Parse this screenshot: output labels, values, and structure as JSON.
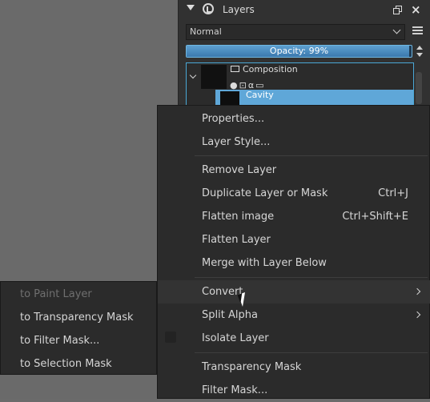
{
  "docker": {
    "title": "Layers",
    "blend_mode": "Normal",
    "opacity_text": "Opacity:  99%",
    "opacity_value": 0.99,
    "layers": [
      {
        "name": "Composition",
        "type": "group"
      },
      {
        "name": "Cavity",
        "type": "paint",
        "selected": true
      }
    ]
  },
  "context_menu": {
    "items": [
      {
        "label": "Properties...",
        "shortcut": ""
      },
      {
        "label": "Layer Style...",
        "shortcut": ""
      },
      {
        "label": "Remove Layer",
        "shortcut": ""
      },
      {
        "label": "Duplicate Layer or Mask",
        "shortcut": "Ctrl+J"
      },
      {
        "label": "Flatten image",
        "shortcut": "Ctrl+Shift+E"
      },
      {
        "label": "Flatten Layer",
        "shortcut": ""
      },
      {
        "label": "Merge with Layer Below",
        "shortcut": ""
      },
      {
        "label": "Convert",
        "shortcut": ""
      },
      {
        "label": "Split Alpha",
        "shortcut": ""
      },
      {
        "label": "Isolate Layer",
        "shortcut": ""
      },
      {
        "label": "Transparency Mask",
        "shortcut": ""
      },
      {
        "label": "Filter Mask...",
        "shortcut": ""
      }
    ]
  },
  "convert_submenu": {
    "items": [
      {
        "label": "to Paint Layer",
        "enabled": false
      },
      {
        "label": "to Transparency Mask",
        "enabled": true
      },
      {
        "label": "to Filter Mask...",
        "enabled": true
      },
      {
        "label": "to Selection Mask",
        "enabled": true
      }
    ]
  }
}
